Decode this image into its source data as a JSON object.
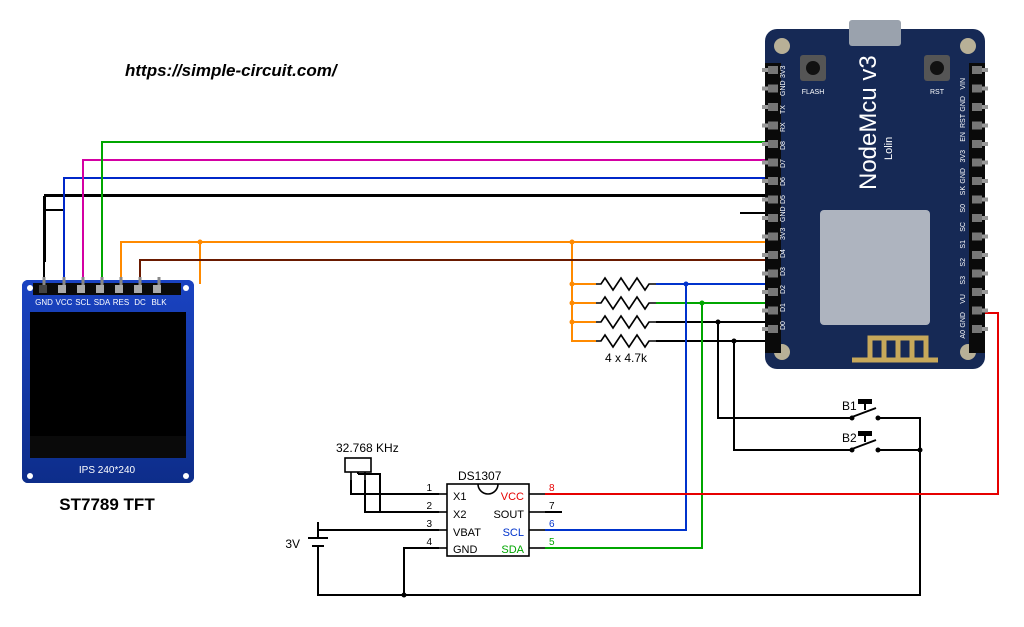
{
  "url": "https://simple-circuit.com/",
  "tft": {
    "label": "ST7789 TFT",
    "marking": "IPS 240*240",
    "pins": [
      "GND",
      "VCC",
      "SCL",
      "SDA",
      "RES",
      "DC",
      "BLK"
    ]
  },
  "mcu": {
    "name": "NodeMcu v3",
    "sub": "Lolin",
    "left_pins": [
      "A0",
      "GND",
      "VU",
      "S3",
      "S2",
      "S1",
      "SC",
      "S0",
      "SK",
      "GND",
      "3V3",
      "EN",
      "RST",
      "GND",
      "VIN"
    ],
    "right_pins": [
      "D0",
      "D1",
      "D2",
      "D3",
      "D4",
      "3V3",
      "GND",
      "D5",
      "D6",
      "D7",
      "D8",
      "RX",
      "TX",
      "GND",
      "3V3"
    ],
    "btn_flash": "FLASH",
    "btn_rst": "RST"
  },
  "resistors": {
    "label": "4 x 4.7k"
  },
  "crystal": {
    "label": "32.768 KHz"
  },
  "battery": {
    "label": "3V"
  },
  "ic": {
    "name": "DS1307",
    "pins_left": [
      "X1",
      "X2",
      "VBAT",
      "GND"
    ],
    "pins_right": [
      "VCC",
      "SOUT",
      "SCL",
      "SDA"
    ],
    "nums_left": [
      "1",
      "2",
      "3",
      "4"
    ],
    "nums_right": [
      "8",
      "7",
      "6",
      "5"
    ]
  },
  "buttons": {
    "b1": "B1",
    "b2": "B2"
  }
}
